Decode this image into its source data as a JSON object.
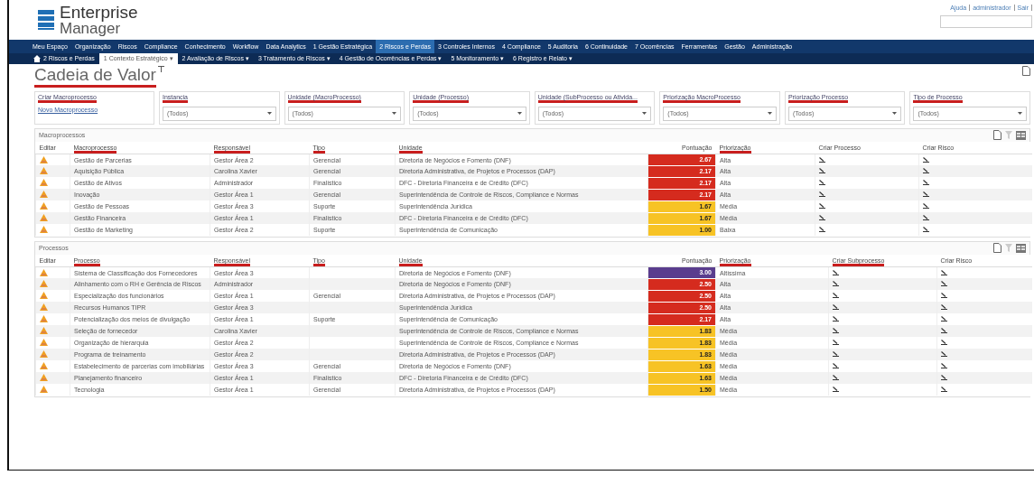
{
  "header": {
    "logo_line1": "Enterprise",
    "logo_line2": "Manager",
    "user_links": [
      "Ajuda",
      "administrador",
      "Sair"
    ]
  },
  "menu": [
    {
      "label": "Meu Espaço",
      "selected": false
    },
    {
      "label": "Organização",
      "selected": false
    },
    {
      "label": "Riscos",
      "selected": false
    },
    {
      "label": "Compliance",
      "selected": false
    },
    {
      "label": "Conhecimento",
      "selected": false
    },
    {
      "label": "Workflow",
      "selected": false
    },
    {
      "label": "Data Analytics",
      "selected": false
    },
    {
      "label": "1 Gestão Estratégica",
      "selected": false
    },
    {
      "label": "2 Riscos e Perdas",
      "selected": true
    },
    {
      "label": "3 Controles Internos",
      "selected": false
    },
    {
      "label": "4 Compliance",
      "selected": false
    },
    {
      "label": "5 Auditoria",
      "selected": false
    },
    {
      "label": "6 Continuidade",
      "selected": false
    },
    {
      "label": "7 Ocorrências",
      "selected": false
    },
    {
      "label": "Ferramentas",
      "selected": false
    },
    {
      "label": "Gestão",
      "selected": false
    },
    {
      "label": "Administração",
      "selected": false
    }
  ],
  "submenu": {
    "home": "2 Riscos e Perdas",
    "caret": "▾",
    "items": [
      {
        "label": "1 Contexto Estratégico",
        "selected": true
      },
      {
        "label": "2 Avaliação de Riscos",
        "selected": false
      },
      {
        "label": "3 Tratamento de Riscos",
        "selected": false
      },
      {
        "label": "4 Gestão de Ocorrências e Perdas",
        "selected": false
      },
      {
        "label": "5 Monitoramento",
        "selected": false
      },
      {
        "label": "6 Registro e Relato",
        "selected": false
      }
    ]
  },
  "page_title": "Cadeia de Valor",
  "create_box": {
    "label": "Criar Macroprocesso",
    "link": "Novo Macroprocesso"
  },
  "filters": [
    {
      "label": "Instancia",
      "value": "(Todos)",
      "underlined": true
    },
    {
      "label": "Unidade (MacroProcesso)",
      "value": "(Todos)",
      "underlined": true
    },
    {
      "label": "Unidade (Processo)",
      "value": "(Todos)",
      "underlined": true
    },
    {
      "label": "Unidade (SubProcesso ou Ativida...",
      "value": "(Todos)",
      "underlined": true
    },
    {
      "label": "Priorização MacroProcesso",
      "value": "(Todos)",
      "underlined": true
    },
    {
      "label": "Priorização Processo",
      "value": "(Todos)",
      "underlined": true
    },
    {
      "label": "Tipo de Processo",
      "value": "(Todos)",
      "underlined": true
    }
  ],
  "tables": [
    {
      "title": "Macroprocessos",
      "columns": [
        {
          "label": "Editar",
          "underlined": false
        },
        {
          "label": "Macroprocesso",
          "underlined": true
        },
        {
          "label": "Responsável",
          "underlined": true
        },
        {
          "label": "Tipo",
          "underlined": true
        },
        {
          "label": "Unidade",
          "underlined": true
        },
        {
          "label": "Pontuação",
          "underlined": false
        },
        {
          "label": "Priorização",
          "underlined": true
        },
        {
          "label": "Criar Processo",
          "underlined": false
        },
        {
          "label": "Criar Risco",
          "underlined": false
        }
      ],
      "rows": [
        {
          "name": "Gestão de Parcerias",
          "owner": "Gestor Área 2",
          "type": "Gerencial",
          "unit": "Diretoria de Negócios e Fomento (DNF)",
          "score": "2.67",
          "color": "#d52b1e",
          "priority": "Alta"
        },
        {
          "name": "Aquisição Pública",
          "owner": "Carolina Xavier",
          "type": "Gerencial",
          "unit": "Diretoria Administrativa, de Projetos e Processos (DAP)",
          "score": "2.17",
          "color": "#d52b1e",
          "priority": "Alta"
        },
        {
          "name": "Gestão de Ativos",
          "owner": "Administrador",
          "type": "Finalístico",
          "unit": "DFC - Diretoria Financeira e de Crédito (DFC)",
          "score": "2.17",
          "color": "#d52b1e",
          "priority": "Alta"
        },
        {
          "name": "Inovação",
          "owner": "Gestor Área 1",
          "type": "Gerencial",
          "unit": "Superintendência de Controle de Riscos, Compliance e Normas",
          "score": "2.17",
          "color": "#d52b1e",
          "priority": "Alta"
        },
        {
          "name": "Gestão de Pessoas",
          "owner": "Gestor Área 3",
          "type": "Suporte",
          "unit": "Superintendência Jurídica",
          "score": "1.67",
          "color": "#f7c325",
          "priority": "Média"
        },
        {
          "name": "Gestão Financeira",
          "owner": "Gestor Área 1",
          "type": "Finalístico",
          "unit": "DFC - Diretoria Financeira e de Crédito (DFC)",
          "score": "1.67",
          "color": "#f7c325",
          "priority": "Média"
        },
        {
          "name": "Gestão de Marketing",
          "owner": "Gestor Área 2",
          "type": "Suporte",
          "unit": "Superintendência de Comunicação",
          "score": "1.00",
          "color": "#f7c325",
          "priority": "Baixa"
        }
      ]
    },
    {
      "title": "Processos",
      "columns": [
        {
          "label": "Editar",
          "underlined": false
        },
        {
          "label": "Processo",
          "underlined": true
        },
        {
          "label": "Responsável",
          "underlined": true
        },
        {
          "label": "Tipo",
          "underlined": true
        },
        {
          "label": "Unidade",
          "underlined": true
        },
        {
          "label": "Pontuação",
          "underlined": false
        },
        {
          "label": "Priorização",
          "underlined": true
        },
        {
          "label": "Criar Subprocesso",
          "underlined": true
        },
        {
          "label": "Criar Risco",
          "underlined": false
        }
      ],
      "rows": [
        {
          "name": "Sistema de Classificação dos Fornecedores",
          "owner": "Gestor Área 3",
          "unit": "Diretoria de Negócios e Fomento (DNF)",
          "score": "3.00",
          "color": "#5a3d8e",
          "priority": "Altíssima"
        },
        {
          "name": "Alinhamento com o RH e Gerência de Riscos",
          "owner": "Administrador",
          "unit": "Diretoria de Negócios e Fomento (DNF)",
          "score": "2.50",
          "color": "#d52b1e",
          "priority": "Alta"
        },
        {
          "name": "Especialização dos funcionários",
          "owner": "Gestor Área 1",
          "type": "Gerencial",
          "unit": "Diretoria Administrativa, de Projetos e Processos (DAP)",
          "score": "2.50",
          "color": "#d52b1e",
          "priority": "Alta"
        },
        {
          "name": "Recursos Humanos TIPR",
          "owner": "Gestor Área 3",
          "unit": "Superintendência Jurídica",
          "score": "2.50",
          "color": "#d52b1e",
          "priority": "Alta"
        },
        {
          "name": "Potencialização dos meios de divulgação",
          "owner": "Gestor Área 1",
          "type": "Suporte",
          "unit": "Superintendência de Comunicação",
          "score": "2.17",
          "color": "#d52b1e",
          "priority": "Alta"
        },
        {
          "name": "Seleção de fornecedor",
          "owner": "Carolina Xavier",
          "unit": "Superintendência de Controle de Riscos, Compliance e Normas",
          "score": "1.83",
          "color": "#f7c325",
          "priority": "Média"
        },
        {
          "name": "Organização de hierarquia",
          "owner": "Gestor Área 2",
          "unit": "Superintendência de Controle de Riscos, Compliance e Normas",
          "score": "1.83",
          "color": "#f7c325",
          "priority": "Média"
        },
        {
          "name": "Programa de treinamento",
          "owner": "Gestor Área 2",
          "unit": "Diretoria Administrativa, de Projetos e Processos (DAP)",
          "score": "1.83",
          "color": "#f7c325",
          "priority": "Média"
        },
        {
          "name": "Estabelecimento de parcerias com imobiliárias",
          "owner": "Gestor Área 3",
          "type": "Gerencial",
          "unit": "Diretoria de Negócios e Fomento (DNF)",
          "score": "1.63",
          "color": "#f7c325",
          "priority": "Média"
        },
        {
          "name": "Planejamento financeiro",
          "owner": "Gestor Área 1",
          "type": "Finalístico",
          "unit": "DFC - Diretoria Financeira e de Crédito (DFC)",
          "score": "1.63",
          "color": "#f7c325",
          "priority": "Média"
        },
        {
          "name": "Tecnologia",
          "owner": "Gestor Área 1",
          "type": "Gerencial",
          "unit": "Diretoria Administrativa, de Projetos e Processos (DAP)",
          "score": "1.50",
          "color": "#f7c325",
          "priority": "Média"
        }
      ]
    }
  ]
}
